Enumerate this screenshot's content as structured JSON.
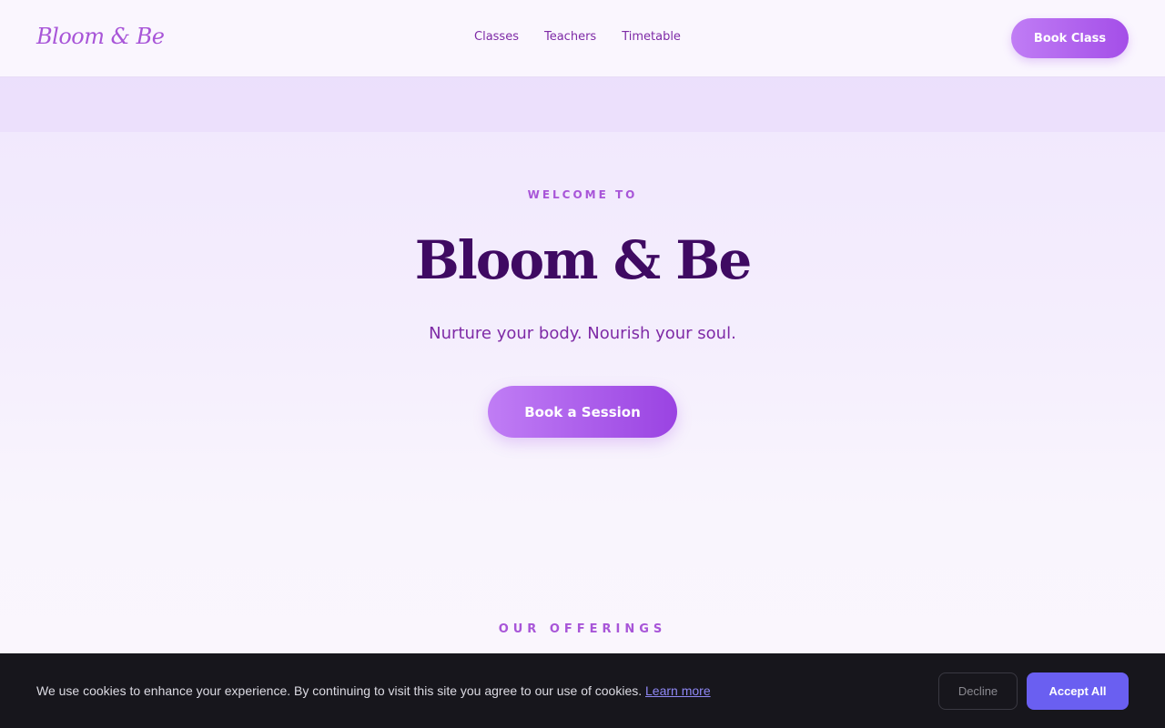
{
  "header": {
    "logo": "Bloom & Be",
    "nav": [
      "Classes",
      "Teachers",
      "Timetable"
    ],
    "cta": "Book Class"
  },
  "hero": {
    "eyebrow": "WELCOME TO",
    "title": "Bloom & Be",
    "tagline": "Nurture your body. Nourish your soul.",
    "cta": "Book a Session"
  },
  "offerings": {
    "heading": "OUR OFFERINGS"
  },
  "cookie_banner": {
    "message": "We use cookies to enhance your experience. By continuing to visit this site you agree to our use of cookies.",
    "link": "Learn more",
    "decline": "Decline",
    "accept": "Accept All"
  },
  "colors": {
    "brand": "#a855d8",
    "heading": "#3f0a62",
    "accent_button": "#6a5ff1"
  }
}
